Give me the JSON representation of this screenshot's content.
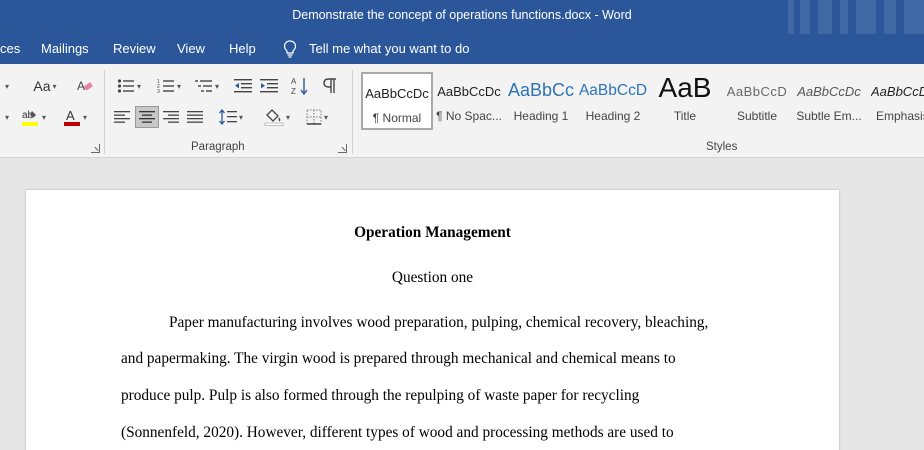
{
  "window": {
    "title": "Demonstrate the concept of operations functions.docx  -  Word"
  },
  "menu": {
    "tabs": [
      "ces",
      "Mailings",
      "Review",
      "View",
      "Help"
    ],
    "tell_me": "Tell me what you want to do"
  },
  "ribbon": {
    "font_group": {
      "change_case": "Aa"
    },
    "paragraph": {
      "label": "Paragraph"
    },
    "styles": {
      "label": "Styles",
      "items": [
        {
          "sample": "AaBbCcDc",
          "name": "¶ Normal"
        },
        {
          "sample": "AaBbCcDc",
          "name": "¶ No Spac..."
        },
        {
          "sample": "AaBbCc",
          "name": "Heading 1"
        },
        {
          "sample": "AaBbCcD",
          "name": "Heading 2"
        },
        {
          "sample": "AaB",
          "name": "Title"
        },
        {
          "sample": "AaBbCcD",
          "name": "Subtitle"
        },
        {
          "sample": "AaBbCcDc",
          "name": "Subtle Em..."
        },
        {
          "sample": "AaBbCcD",
          "name": "Emphasis"
        }
      ]
    }
  },
  "colors": {
    "brand": "#2b579a",
    "font_color": "#c00000",
    "highlight": "#ffff00"
  },
  "document": {
    "title": "Operation Management",
    "subtitle": "Question one",
    "lines": [
      "Paper manufacturing involves wood preparation, pulping, chemical recovery, bleaching,",
      "and papermaking. The virgin wood is prepared through mechanical and chemical means to",
      "produce pulp. Pulp is also formed through the repulping of waste paper for recycling",
      "(Sonnenfeld, 2020). However, different types of wood and processing methods are used to"
    ]
  }
}
